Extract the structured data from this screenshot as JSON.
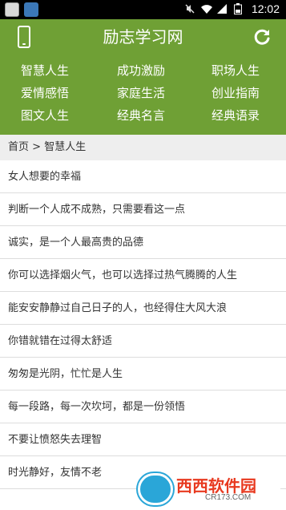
{
  "statusbar": {
    "time": "12:02",
    "icons": [
      "notification-icon",
      "app-icon",
      "mute-icon",
      "wifi-icon",
      "signal-icon",
      "battery-icon"
    ]
  },
  "header": {
    "title": "励志学习网",
    "left_icon": "phone-icon",
    "right_icon": "refresh-icon",
    "color": "#6fa035"
  },
  "categories": [
    "智慧人生",
    "成功激励",
    "职场人生",
    "爱情感悟",
    "家庭生活",
    "创业指南",
    "图文人生",
    "经典名言",
    "经典语录"
  ],
  "breadcrumb": {
    "home": "首页",
    "sep": ">",
    "current": "智慧人生"
  },
  "articles": [
    "女人想要的幸福",
    "判断一个人成不成熟，只需要看这一点",
    "诚实，是一个人最高贵的品德",
    "你可以选择烟火气，也可以选择过热气腾腾的人生",
    "能安安静静过自己日子的人，也经得住大风大浪",
    "你错就错在过得太舒适",
    "匆匆是光阴，忙忙是人生",
    "每一段路，每一次坎坷，都是一份领悟",
    "不要让愤怒失去理智",
    "时光静好，友情不老"
  ],
  "watermark": {
    "main": "西西软件园",
    "sub": "CR173.COM"
  }
}
